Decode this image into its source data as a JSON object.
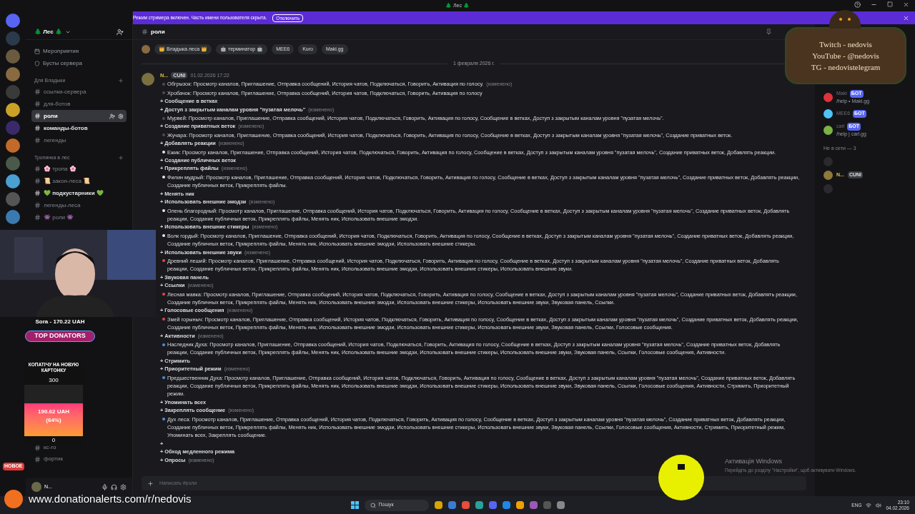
{
  "titlebar": {
    "title": "🌲 Лес 🌲"
  },
  "banner": {
    "text": "Режим стримера включен. Часть имени пользователя скрыта.",
    "button": "Отключить"
  },
  "server": {
    "name": "🌲 Лес 🌲"
  },
  "sidebar": {
    "top_items": [
      "Мероприятия",
      "Бусты сервера"
    ],
    "categories": [
      {
        "name": "Для Владыки",
        "channels": [
          {
            "name": "ссылки-сервера",
            "selected": false,
            "unread": false
          },
          {
            "name": "для-ботов",
            "selected": false,
            "unread": false
          },
          {
            "name": "роли",
            "selected": true,
            "unread": true
          },
          {
            "name": "команды-ботов",
            "selected": false,
            "unread": true
          },
          {
            "name": "легенды",
            "selected": false,
            "unread": false
          }
        ]
      },
      {
        "name": "Тропинка в лес",
        "channels": [
          {
            "name": "🌸 тропа 🌸",
            "selected": false,
            "unread": false
          },
          {
            "name": "📜 закон-леса 📜",
            "selected": false,
            "unread": false
          },
          {
            "name": "💚 подкустарники 💚",
            "selected": false,
            "unread": true
          },
          {
            "name": "легенды-леса",
            "selected": false,
            "unread": false
          },
          {
            "name": "👾 роли 👾",
            "selected": false,
            "unread": false
          }
        ]
      }
    ],
    "bottom_channels": [
      "кс-го",
      "фортик"
    ]
  },
  "user_panel": {
    "name": "N...",
    "badge": "НОВОЕ"
  },
  "channel": {
    "name": "роли",
    "tags": [
      "👑 Владыка леса 👑",
      "🤖 терминатор 🤖",
      "MEE6",
      "Kuro",
      "Maki.gg"
    ]
  },
  "date_divider": "1 февраля 2026 г.",
  "message": {
    "author": "N...",
    "tag": "CUNI",
    "time": "01.02.2026 17:22",
    "lines": [
      {
        "kind": "role",
        "color": "#4b4d52",
        "text": "Обгрызок: Просмотр каналов, Приглашение, Отправка сообщений, История чатов, Подключаться, Говорить, Активация по голосу.",
        "note": "(изменено)"
      },
      {
        "kind": "role",
        "color": "#4b4d52",
        "text": "Хробачок: Просмотр каналов, Приглашение, Отправка сообщений, История чатов, Подключаться, Говорить, Активация по голосу"
      },
      {
        "kind": "add",
        "text": "+ Сообщение в ветках"
      },
      {
        "kind": "add",
        "text": "+ Доступ з закрытым каналам уровня \"пузатая мелочь\"",
        "note": "(изменено)"
      },
      {
        "kind": "role",
        "color": "#4b4d52",
        "text": "Мурвей: Просмотр каналов, Приглашение, Отправка сообщений, История чатов, Подключаться, Говорить, Активация по голосу, Сообщение в ветках, Доступ з закрытым каналам уровня \"пузатая мелочь\"."
      },
      {
        "kind": "add",
        "text": "+ Создание приватных веток",
        "note": "(изменено)"
      },
      {
        "kind": "role",
        "color": "#4b4d52",
        "text": "Жучара: Просмотр каналов, Приглашение, Отправка сообщений, История чатов, Подключаться, Говорить, Активация по голосу, Сообщение в ветках, Доступ з закрытым каналам уровня \"пузатая мелочь\", Создание приватных веток."
      },
      {
        "kind": "add",
        "text": "+ Добавлять реакции",
        "note": "(изменено)"
      },
      {
        "kind": "role",
        "color": "#e6e6e6",
        "text": "Ежик: Просмотр каналов, Приглашение, Отправка сообщений, История чатов, Подключаться, Говорить, Активация по голосу, Сообщение в ветках, Доступ з закрытым каналам уровня \"пузатая мелочь\", Создание приватных веток, Добавлять реакции."
      },
      {
        "kind": "add",
        "text": "+ Создание публичных веток"
      },
      {
        "kind": "add",
        "text": "+ Прикреплять файлы",
        "note": "(изменено)"
      },
      {
        "kind": "role",
        "color": "#e6e6e6",
        "text": "Филин мудрый: Просмотр каналов, Приглашение, Отправка сообщений, История чатов, Подключаться, Говорить, Активация по голосу, Сообщение в ветках, Доступ з закрытым каналам уровня \"пузатая мелочь\", Создание приватных веток, Добавлять реакции, Создание публичных веток, Прикреплять файлы."
      },
      {
        "kind": "add",
        "text": "+ Менять ник"
      },
      {
        "kind": "add",
        "text": "+ Использовать внешние эмодзи",
        "note": "(изменено)"
      },
      {
        "kind": "role",
        "color": "#e6e6e6",
        "text": "Олень благородный: Просмотр каналов, Приглашение, Отправка сообщений, История чатов, Подключаться, Говорить, Активация по голосу, Сообщение в ветках, Доступ з закрытым каналам уровня \"пузатая мелочь\", Создание приватных веток, Добавлять реакции, Создание публичных веток, Прикреплять файлы, Менять ник, Использовать внешние эмодзи."
      },
      {
        "kind": "add",
        "text": "+ Использовать внешние стикеры",
        "note": "(изменено)"
      },
      {
        "kind": "role",
        "color": "#e6e6e6",
        "text": "Волк гордый: Просмотр каналов, Приглашение, Отправка сообщений, История чатов, Подключаться, Говорить, Активация по голосу, Сообщение в ветках, Доступ з закрытым каналам уровня \"пузатая мелочь\", Создание приватных веток, Добавлять реакции, Создание публичных веток, Прикреплять файлы, Менять ник, Использовать внешние эмодзи, Использовать внешние стикеры."
      },
      {
        "kind": "add",
        "text": "+ Использовать внешние звуки",
        "note": "(изменено)"
      },
      {
        "kind": "role",
        "color": "#e04848",
        "text": "Древний леший: Просмотр каналов, Приглашение, Отправка сообщений, История чатов, Подключаться, Говорить, Активация по голосу, Сообщение в ветках, Доступ з закрытым каналам уровня \"пузатая мелочь\", Создание приватных веток, Добавлять реакции, Создание публичных веток, Прикреплять файлы, Менять ник, Использовать внешние эмодзи, Использовать внешние стикеры, Использовать внешние звуки."
      },
      {
        "kind": "add",
        "text": "+ Звуковая панель"
      },
      {
        "kind": "add",
        "text": "+ Ссылки",
        "note": "(изменено)"
      },
      {
        "kind": "role",
        "color": "#e04848",
        "text": "Лесная мавка: Просмотр каналов, Приглашение, Отправка сообщений, История чатов, Подключаться, Говорить, Активация по голосу, Сообщение в ветках, Доступ з закрытым каналам уровня \"пузатая мелочь\", Создание приватных веток, Добавлять реакции, Создание публичных веток, Прикреплять файлы, Менять ник, Использовать внешние эмодзи, Использовать внешние стикеры, Использовать внешние звуки, Звуковая панель, Ссылки."
      },
      {
        "kind": "add",
        "text": "+ Голосовые сообщения",
        "note": "(изменено)"
      },
      {
        "kind": "role",
        "color": "#e04848",
        "text": "Змей горыныч: Просмотр каналов, Приглашение, Отправка сообщений, История чатов, Подключаться, Говорить, Активация по голосу, Сообщение в ветках, Доступ з закрытым каналам уровня \"пузатая мелочь\", Создание приватных веток, Добавлять реакции, Создание публичных веток, Прикреплять файлы, Менять ник, Использовать внешние эмодзи, Использовать внешние стикеры, Использовать внешние звуки, Звуковая панель, Ссылки, Голосовые сообщения."
      },
      {
        "kind": "add",
        "text": "+ Активности",
        "note": "(изменено)"
      },
      {
        "kind": "role",
        "color": "#4a90e2",
        "text": "Наследник Духа: Просмотр каналов, Приглашение, Отправка сообщений, История чатов, Подключаться, Говорить, Активация по голосу, Сообщение в ветках, Доступ з закрытым каналам уровня \"пузатая мелочь\", Создание приватных веток, Добавлять реакции, Создание публичных веток, Прикреплять файлы, Менять ник, Использовать внешние эмодзи, Использовать внешние стикеры, Использовать внешние звуки, Звуковая панель, Ссылки, Голосовые сообщения, Активности."
      },
      {
        "kind": "add",
        "text": "+ Стримить"
      },
      {
        "kind": "add",
        "text": "+ Приоритетный режим",
        "note": "(изменено)"
      },
      {
        "kind": "role",
        "color": "#4a90e2",
        "text": "Предшественник Духа: Просмотр каналов, Приглашение, Отправка сообщений, История чатов, Подключаться, Говорить, Активация по голосу, Сообщение в ветках, Доступ з закрытым каналам уровня \"пузатая мелочь\", Создание приватных веток, Добавлять реакции, Создание публичных веток, Прикреплять файлы, Менять ник, Использовать внешние эмодзи, Использовать внешние стикеры, Использовать внешние звуки, Звуковая панель, Ссылки, Голосовые сообщения, Активности, Стримить, Приоритетный режим."
      },
      {
        "kind": "add",
        "text": "+ Упоминать всех"
      },
      {
        "kind": "add",
        "text": "+ Закреплять сообщение",
        "note": "(изменено)"
      },
      {
        "kind": "role",
        "color": "#4a90e2",
        "text": "Дух леса: Просмотр каналов, Приглашение, Отправка сообщений, История чатов, Подключаться, Говорить, Активация по голосу, Сообщение в ветках, Доступ з закрытым каналам уровня \"пузатая мелочь\", Создание приватных веток, Добавлять реакции, Создание публичных веток, Прикреплять файлы, Менять ник, Использовать внешние эмодзи, Использовать внешние стикеры, Использовать внешние звуки, Звуковая панель, Ссылки, Голосовые сообщения, Активности, Стримить, Приоритетный режим, Упоминать всех, Закреплять сообщение."
      },
      {
        "kind": "add",
        "text": "+"
      },
      {
        "kind": "add",
        "text": "+ Обход медленного режима"
      },
      {
        "kind": "add",
        "text": "+ Опросы",
        "note": "(изменено)"
      }
    ]
  },
  "composer": {
    "placeholder": "Написать #роли"
  },
  "members": {
    "online": [
      {
        "name": "Maki",
        "badge": "БОТ",
        "status": "/help • Maki.gg",
        "color": "#e0323c"
      },
      {
        "name": "MEE6",
        "badge": "БОТ",
        "color": "#4fc3f7"
      },
      {
        "name": "carl",
        "badge": "БОТ",
        "status": "/help | carl.gg",
        "color": "#7cb342"
      }
    ],
    "offline_header": "Не в сети — 3",
    "offline": [
      {
        "name": "N...",
        "badge": "CUNI",
        "color": "#8d7a3a"
      }
    ]
  },
  "overlay": {
    "sign_lines": [
      "Twitch - nedovis",
      "YouTube - @nedovis",
      "TG - nedovistelegram"
    ],
    "top_donator": "Sora - 170.22 UAH",
    "top_label": "TOP DONATORS",
    "goal": {
      "title": "КОПАТІЧУ НА НОВУЮ КАРТОНКУ",
      "max": "300",
      "amount": "190.62 UAH",
      "percent": "(64%)",
      "min": "0"
    },
    "url": "www.donationalerts.com/r/nedovis"
  },
  "activation": {
    "title": "Активація Windows",
    "text": "Перейдіть до розділу \"Настройки\", щоб активувати Windows."
  },
  "taskbar": {
    "search": "Пошук",
    "lang": "ENG",
    "time": "23:10",
    "date": "04.02.2026"
  }
}
